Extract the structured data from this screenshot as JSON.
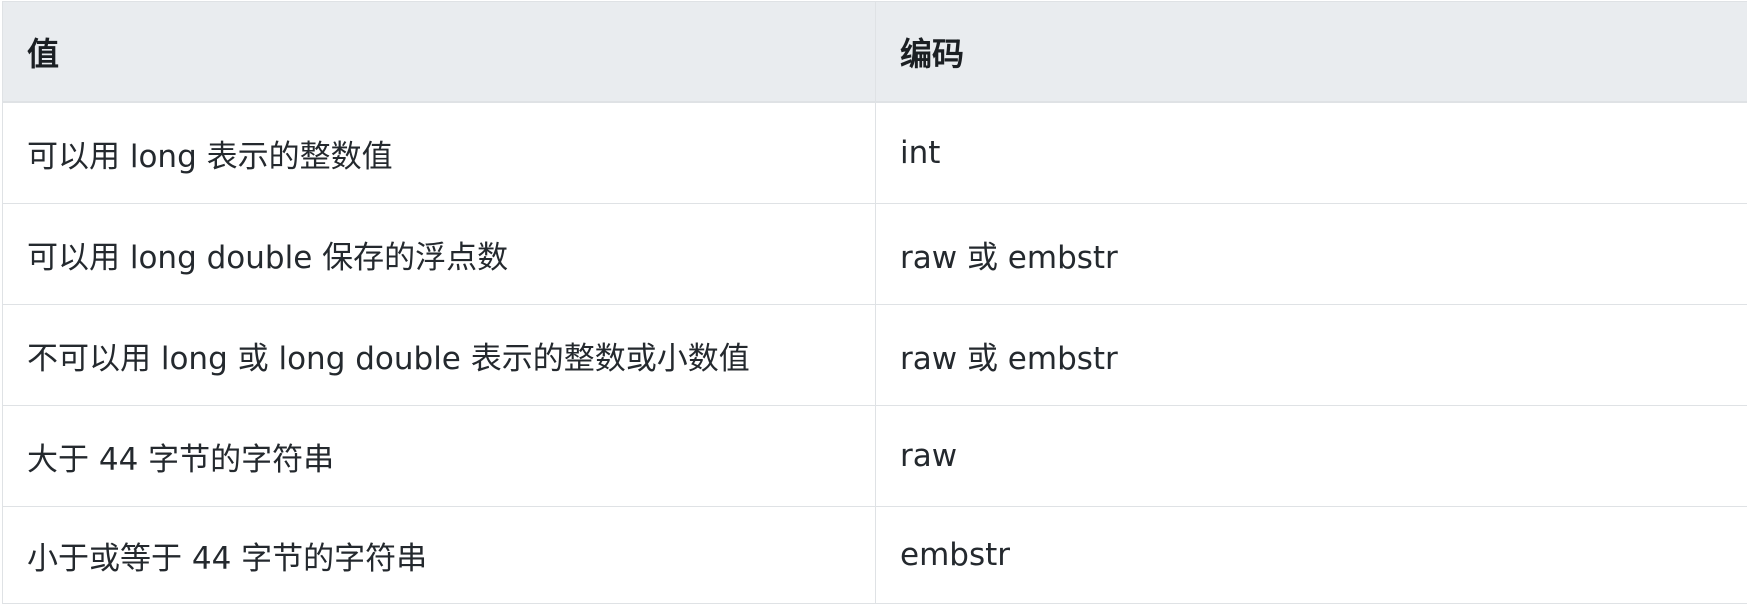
{
  "table": {
    "headers": [
      "值",
      "编码"
    ],
    "rows": [
      [
        "可以用 long 表示的整数值",
        "int"
      ],
      [
        "可以用 long double 保存的浮点数",
        "raw 或 embstr"
      ],
      [
        "不可以用 long 或 long double 表示的整数或小数值",
        "raw 或 embstr"
      ],
      [
        "大于 44 字节的字符串",
        "raw"
      ],
      [
        "小于或等于 44 字节的字符串",
        "embstr"
      ]
    ]
  },
  "colors": {
    "header_background": "#e9ecef",
    "border": "#dfe2e5",
    "text": "#24292e"
  }
}
